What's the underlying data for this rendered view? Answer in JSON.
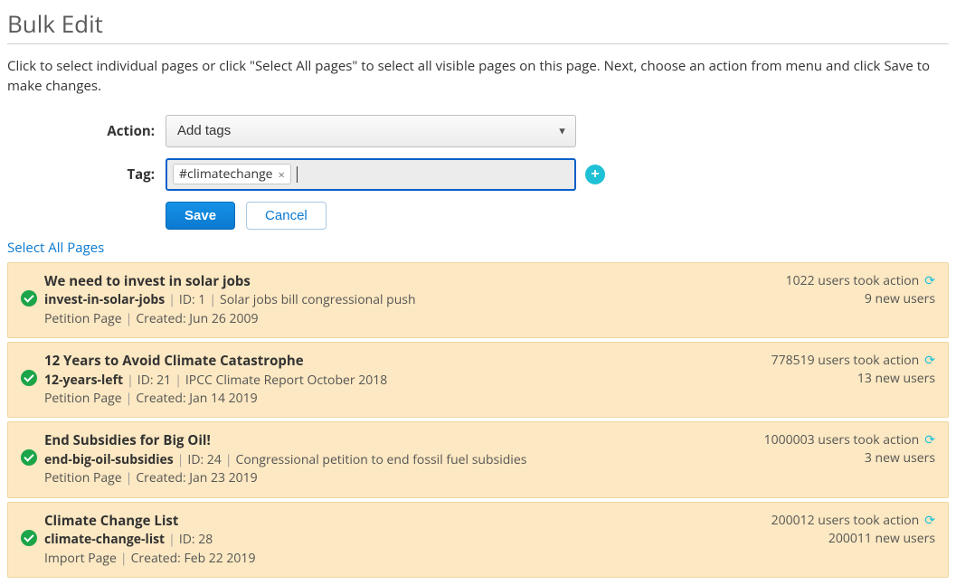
{
  "page_title": "Bulk Edit",
  "intro": "Click to select individual pages or click \"Select All pages\" to select all visible pages on this page. Next, choose an action from menu and click Save to make changes.",
  "form": {
    "action_label": "Action:",
    "action_value": "Add tags",
    "tag_label": "Tag:",
    "tag_chip": "#climatechange",
    "tag_chip_x": "×"
  },
  "buttons": {
    "save": "Save",
    "cancel": "Cancel",
    "add": "+"
  },
  "select_all": "Select All Pages",
  "pages": [
    {
      "title": "We need to invest in solar jobs",
      "slug": "invest-in-solar-jobs",
      "id_label": "ID: 1",
      "desc": "Solar jobs bill congressional push",
      "type": "Petition Page",
      "created": "Created: Jun 26 2009",
      "stat1": "1022 users took action",
      "stat2": "9 new users"
    },
    {
      "title": "12 Years to Avoid Climate Catastrophe",
      "slug": "12-years-left",
      "id_label": "ID: 21",
      "desc": "IPCC Climate Report October 2018",
      "type": "Petition Page",
      "created": "Created: Jan 14 2019",
      "stat1": "778519 users took action",
      "stat2": "13 new users"
    },
    {
      "title": "End Subsidies for Big Oil!",
      "slug": "end-big-oil-subsidies",
      "id_label": "ID: 24",
      "desc": "Congressional petition to end fossil fuel subsidies",
      "type": "Petition Page",
      "created": "Created: Jan 23 2019",
      "stat1": "1000003 users took action",
      "stat2": "3 new users"
    },
    {
      "title": "Climate Change List",
      "slug": "climate-change-list",
      "id_label": "ID: 28",
      "desc": "",
      "type": "Import Page",
      "created": "Created: Feb 22 2019",
      "stat1": "200012 users took action",
      "stat2": "200011 new users"
    }
  ]
}
